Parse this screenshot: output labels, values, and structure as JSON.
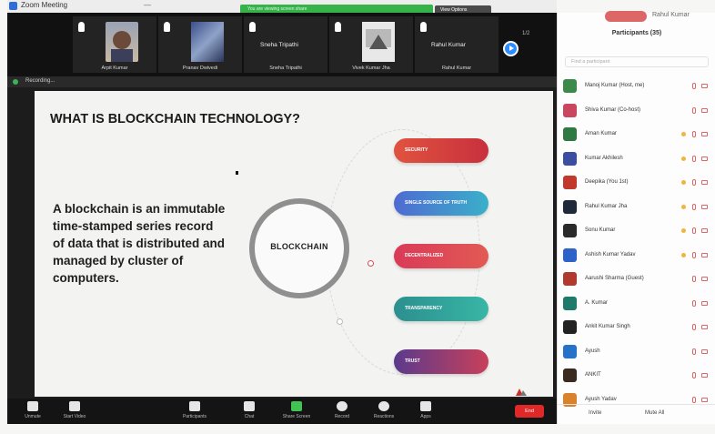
{
  "window": {
    "title": "Zoom Meeting",
    "minimize": "—"
  },
  "banner": {
    "text": "You are viewing screen share",
    "view_options": "View Options"
  },
  "tiles": [
    {
      "name": "Arpit Kumar",
      "kind": "photo"
    },
    {
      "name": "Pranav Dwivedi",
      "kind": "photo2"
    },
    {
      "name": "Sneha Tripathi",
      "caption": "Sneha Tripathi",
      "kind": "name"
    },
    {
      "name": "Vivek Kumar Jha",
      "kind": "photo3"
    },
    {
      "name": "Rahul Kumar",
      "caption": "Rahul Kumar",
      "kind": "name"
    }
  ],
  "strip": {
    "page_indicator": "1/2"
  },
  "recording": {
    "label": "Recording..."
  },
  "slide": {
    "title": "WHAT IS BLOCKCHAIN TECHNOLOGY?",
    "body": "A blockchain is an immutable time-stamped series record of data that is distributed and managed by cluster of computers.",
    "center_label": "BLOCKCHAIN",
    "pills": [
      {
        "label": "SECURITY",
        "color": "#e0533f",
        "color2": "#c8303d"
      },
      {
        "label": "SINGLE SOURCE OF TRUTH",
        "color": "#4f6bd2",
        "color2": "#3ab0c9"
      },
      {
        "label": "DECENTRALIZED",
        "color": "#d93a58",
        "color2": "#e25a54"
      },
      {
        "label": "TRANSPARENCY",
        "color": "#2c8f8f",
        "color2": "#38b6a5"
      },
      {
        "label": "TRUST",
        "color": "#5b3a8c",
        "color2": "#c8405a"
      }
    ]
  },
  "toolbar": {
    "items": [
      {
        "label": "Unmute",
        "icon": "mic-icon"
      },
      {
        "label": "Start Video",
        "icon": "video-icon"
      },
      {
        "label": "Participants",
        "icon": "participants-icon",
        "count": "35"
      },
      {
        "label": "Chat",
        "icon": "chat-icon"
      },
      {
        "label": "Share Screen",
        "icon": "share-icon"
      },
      {
        "label": "Record",
        "icon": "record-icon"
      },
      {
        "label": "Reactions",
        "icon": "reactions-icon"
      },
      {
        "label": "Apps",
        "icon": "apps-icon"
      }
    ],
    "end_label": "End"
  },
  "panel": {
    "top_user": "Rahul Kumar",
    "header": "Participants (35)",
    "search_placeholder": "Find a participant",
    "participants": [
      {
        "name": "Manoj Kumar (Host, me)",
        "color": "#3c8a4a",
        "hand": false
      },
      {
        "name": "Shiva Kumar (Co-host)",
        "color": "#c9465d",
        "hand": false
      },
      {
        "name": "Aman Kumar",
        "color": "#2f7a43",
        "hand": true
      },
      {
        "name": "Kumar Akhilesh",
        "color": "#3a4fa0",
        "hand": true
      },
      {
        "name": "Deepika (You 1st)",
        "color": "#c0392b",
        "hand": true
      },
      {
        "name": "Rahul Kumar Jha",
        "color": "#1f2a3a",
        "hand": true
      },
      {
        "name": "Sonu Kumar",
        "color": "#2a2a2a",
        "hand": true
      },
      {
        "name": "Ashish Kumar Yadav",
        "color": "#2d63c9",
        "hand": true
      },
      {
        "name": "Aarushi Sharma (Guest)",
        "color": "#b03a2e",
        "hand": false
      },
      {
        "name": "A. Kumar",
        "color": "#1e7b6c",
        "hand": false
      },
      {
        "name": "Ankit Kumar Singh",
        "color": "#222",
        "hand": false
      },
      {
        "name": "Ayush",
        "color": "#2672c7",
        "hand": false
      },
      {
        "name": "ANKIT",
        "color": "#3a2a20",
        "hand": false
      },
      {
        "name": "Ayush Yadav",
        "color": "#d9822b",
        "hand": false
      }
    ],
    "footer": {
      "invite": "Invite",
      "mute_all": "Mute All"
    }
  }
}
